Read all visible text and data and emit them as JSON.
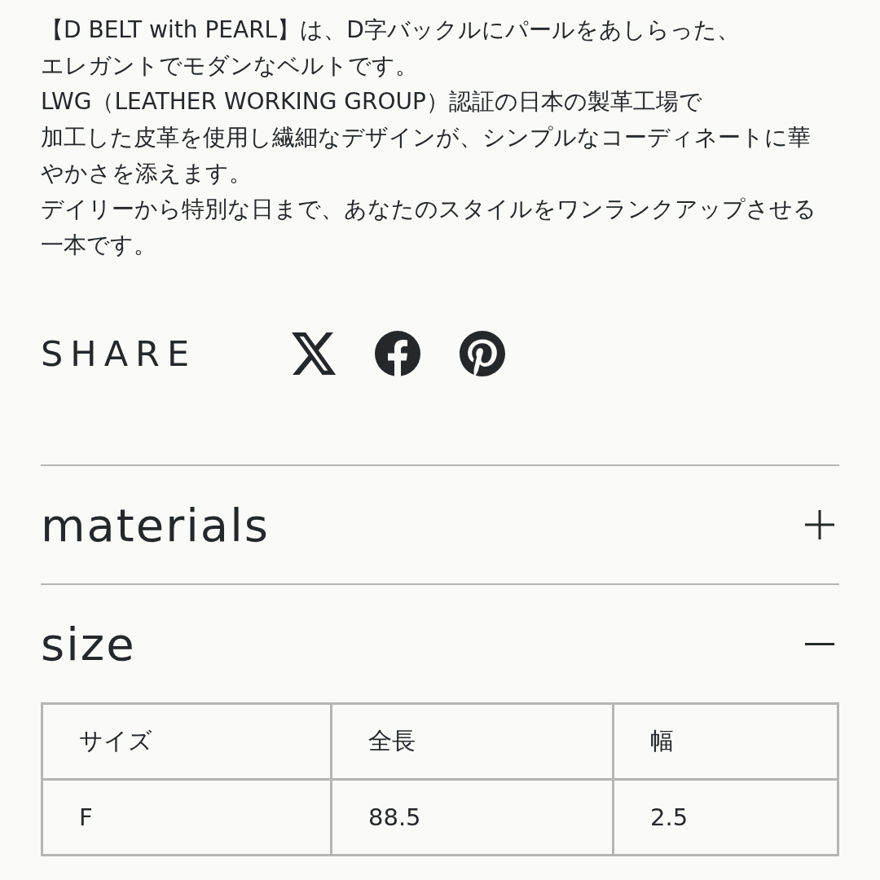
{
  "description": {
    "paragraphs": [
      {
        "lines": [
          "【D BELT with PEARL】は、D字バックルにパールをあしらった、",
          "エレガントでモダンなベルトです。"
        ]
      },
      {
        "lines": [
          "LWG（LEATHER WORKING GROUP）認証の日本の製革工場で",
          "加工した皮革を使用し繊細なデザインが、シンプルなコーディネートに華",
          "やかさを添えます。"
        ]
      },
      {
        "lines": [
          "デイリーから特別な日まで、あなたのスタイルをワンランクアップさせる",
          "一本です。"
        ]
      }
    ]
  },
  "share": {
    "label": "SHARE",
    "links": [
      {
        "kind": "x"
      },
      {
        "kind": "facebook"
      },
      {
        "kind": "pinterest"
      }
    ]
  },
  "sections": [
    {
      "title": "materials",
      "expanded": false
    },
    {
      "title": "size",
      "expanded": true,
      "table": {
        "columns": [
          "サイズ",
          "全長",
          "幅"
        ],
        "rows": [
          [
            "F",
            "88.5",
            "2.5"
          ]
        ]
      }
    }
  ]
}
